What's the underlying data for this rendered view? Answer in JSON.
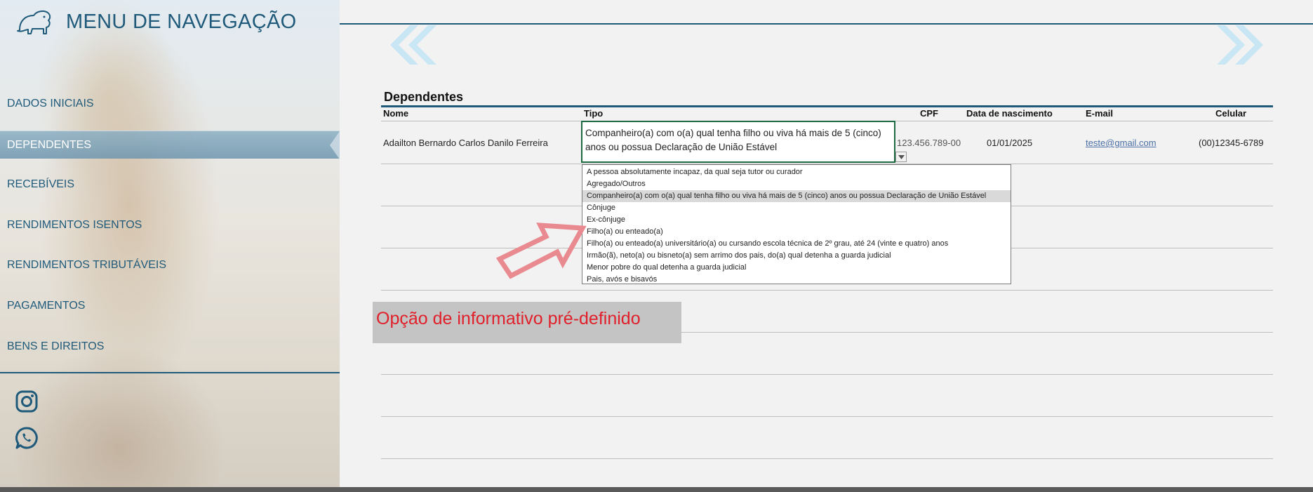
{
  "sidebar": {
    "title": "MENU DE NAVEGAÇÃO",
    "logo_icon": "lion-logo-icon",
    "items": [
      {
        "label": "DADOS INICIAIS",
        "active": false
      },
      {
        "label": "DEPENDENTES",
        "active": true
      },
      {
        "label": "RECEBÍVEIS",
        "active": false
      },
      {
        "label": "RENDIMENTOS ISENTOS",
        "active": false
      },
      {
        "label": "RENDIMENTOS TRIBUTÁVEIS",
        "active": false
      },
      {
        "label": "PAGAMENTOS",
        "active": false
      },
      {
        "label": "BENS E DIREITOS",
        "active": false
      }
    ],
    "social": [
      "instagram-icon",
      "whatsapp-icon"
    ]
  },
  "colors": {
    "primary": "#1f5a7a",
    "chevron": "#c9e6f4",
    "selected_border": "#1e6b43",
    "note_text": "#e0202a",
    "note_bg": "#c4c4c4",
    "arrow": "#e88a8f"
  },
  "main": {
    "section_title": "Dependentes",
    "columns": {
      "nome": "Nome",
      "tipo": "Tipo",
      "cpf": "CPF",
      "nascimento": "Data de nascimento",
      "email": "E-mail",
      "celular": "Celular"
    },
    "row": {
      "nome": "Adailton Bernardo Carlos Danilo Ferreira",
      "tipo": "Companheiro(a) com o(a) qual tenha filho ou viva há mais de 5 (cinco) anos ou possua Declaração de União Estável",
      "cpf": "123.456.789-00",
      "nascimento": "01/01/2025",
      "email": "teste@gmail.com",
      "celular": "(00)12345-6789"
    },
    "dropdown": {
      "selected_index": 2,
      "options": [
        "A pessoa absolutamente incapaz, da qual seja tutor ou curador",
        "Agregado/Outros",
        "Companheiro(a) com o(a) qual tenha filho ou viva há mais de 5 (cinco) anos ou possua Declaração de União Estável",
        "Cônjuge",
        "Ex-cônjuge",
        "Filho(a) ou enteado(a)",
        "Filho(a) ou enteado(a) universitário(a) ou cursando escola técnica de 2º grau, até 24 (vinte e quatro) anos",
        "Irmão(ã), neto(a) ou bisneto(a) sem arrimo dos pais, do(a) qual detenha a guarda judicial",
        "Menor pobre do qual detenha a guarda judicial",
        "Pais, avós e bisavós"
      ]
    },
    "note": "Opção de informativo pré-definido"
  }
}
